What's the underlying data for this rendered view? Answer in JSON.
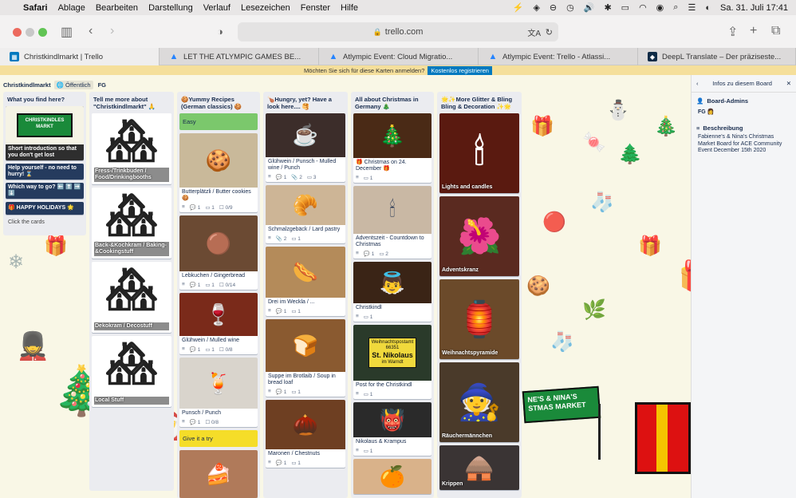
{
  "menubar": {
    "apple": "",
    "app": "Safari",
    "items": [
      "Ablage",
      "Bearbeiten",
      "Darstellung",
      "Verlauf",
      "Lesezeichen",
      "Fenster",
      "Hilfe"
    ],
    "clock": "Sa. 31. Juli  17:41"
  },
  "browser": {
    "url": "trello.com",
    "tabs": [
      {
        "label": "Christkindlmarkt | Trello",
        "color": "#0079bf",
        "glyph": "▦"
      },
      {
        "label": "LET THE ATLYMPIC GAMES BE...",
        "color": "#2684ff",
        "glyph": "🔥"
      },
      {
        "label": "Atlympic Event: Cloud Migratio...",
        "color": "#2684ff",
        "glyph": "🏁"
      },
      {
        "label": "Atlympic Event: Trello - Atlassi...",
        "color": "#2684ff",
        "glyph": "🚀"
      },
      {
        "label": "DeepL Translate – Der präziseste...",
        "color": "#0f2b46",
        "glyph": "◆"
      }
    ]
  },
  "signup": {
    "text": "Möchten Sie sich für diese Karten anmelden?",
    "button": "Kostenlos registrieren"
  },
  "board": {
    "title": "Christkindlmarkt",
    "visibility": "Öffentlich",
    "member": "FG"
  },
  "lists": [
    {
      "title": "What you find here?",
      "cards": [
        {
          "text": "Short introduction so that you don't get lost"
        },
        {
          "text": "Help yourself - no need to hurry! ⌛"
        },
        {
          "text": "Which way to go? ⬅️ ⬆️ ➡️ ⬇️"
        },
        {
          "text": "🎁 HAPPY HOLIDAYS 🌟"
        }
      ],
      "footer": "Click the cards"
    },
    {
      "title": "Tell me more about \"Christkindlmarkt\" 🙏",
      "cards": [
        {
          "text": "Fress-/Trinkbuden / Food/Drinkingbooths"
        },
        {
          "text": "Back-&Kochkram / Baking-&Cookingstuff"
        },
        {
          "text": "Dekokram / Decostuff"
        },
        {
          "text": "Local Stuff"
        }
      ]
    },
    {
      "title": "🍪Yummy Recipes (German classics) 🍪",
      "labels": [
        "Easy",
        "Give it a try"
      ],
      "cards": [
        {
          "text": "Butterplätzli / Butter cookies 🍪",
          "badges": [
            "≡",
            "💬 1",
            "▭ 1",
            "☐ 0/9"
          ]
        },
        {
          "text": "Lebkuchen / Gingerbread",
          "badges": [
            "≡",
            "💬 1",
            "▭ 1",
            "☐ 0/14"
          ]
        },
        {
          "text": "Glühwein / Mulled wine",
          "badges": [
            "≡",
            "💬 1",
            "▭ 1",
            "☐ 0/8"
          ]
        },
        {
          "text": "Punsch / Punch",
          "badges": [
            "≡",
            "💬 1",
            "☐ 0/8"
          ]
        }
      ]
    },
    {
      "title": "🍗Hungry, yet? Have a look here.... 🥞",
      "cards": [
        {
          "text": "Glühwein / Punsch - Mulled wine / Punch",
          "badges": [
            "≡",
            "💬 1",
            "📎 2",
            "▭ 3"
          ]
        },
        {
          "text": "Schmalzgebäck / Lard pastry",
          "badges": [
            "≡",
            "📎 2",
            "▭ 1"
          ]
        },
        {
          "text": "Drei im Weckla / ...",
          "badges": [
            "≡",
            "💬 1",
            "▭ 1"
          ]
        },
        {
          "text": "Suppe im Brotlaib / Soup in bread loaf",
          "badges": [
            "≡",
            "💬 1",
            "▭ 1"
          ]
        },
        {
          "text": "Maronen / Chestnuts",
          "badges": [
            "≡",
            "💬 1",
            "▭ 1"
          ]
        }
      ]
    },
    {
      "title": "All about Christmas in Germany 🎄",
      "cards": [
        {
          "text": "🎁 Christmas on 24. December 🎁",
          "badges": [
            "≡",
            "▭ 1"
          ]
        },
        {
          "text": "Adventszeit - Countdown to Christmas",
          "badges": [
            "≡",
            "💬 1",
            "▭ 2"
          ]
        },
        {
          "text": "Christkindl",
          "badges": [
            "≡",
            "▭ 1"
          ]
        },
        {
          "text": "Post for the Christkindl",
          "badges": [
            "≡",
            "▭ 1"
          ]
        },
        {
          "text": "Nikolaus & Krampus",
          "badges": [
            "≡",
            "▭ 1"
          ]
        }
      ],
      "sign": [
        "Weihnachtspostamt",
        "66351",
        "St. Nikolaus",
        "im Warndt"
      ]
    },
    {
      "title": "🌟✨More Glitter & Bling Bling & Decoration ✨🌟",
      "cards": [
        {
          "text": "Lights and candles"
        },
        {
          "text": "Adventskranz"
        },
        {
          "text": "Weihnachtspyramide"
        },
        {
          "text": "Räuchermännchen"
        },
        {
          "text": "Krippen"
        }
      ]
    }
  ],
  "panel": {
    "title": "Infos zu diesem Board",
    "admins_label": "Board-Admins",
    "admin": "FG",
    "desc_label": "Beschreibung",
    "description": "Fabienne's & Nina's Christmas Market Board for ACE Community Event December 15th 2020"
  },
  "banner": {
    "text": "CHRISTKINDLES MARKT",
    "text_flag": "FABIENNE'S & NINA'S CHRISTMAS MARKET",
    "bottom_text": "NE'S & NINA'S\nSTMAS MARKET"
  }
}
